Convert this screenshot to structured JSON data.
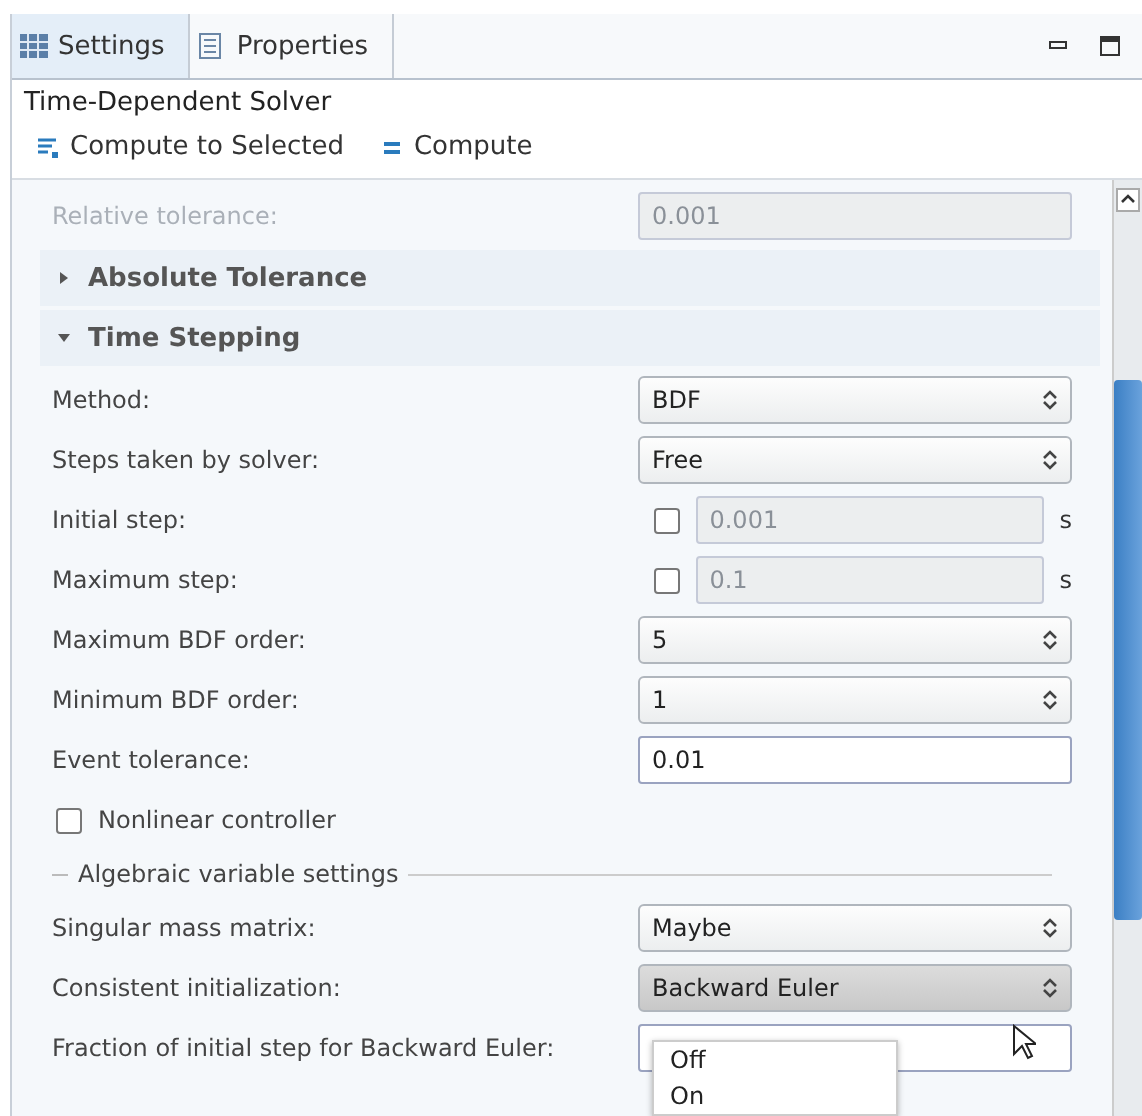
{
  "tabs": [
    {
      "label": "Settings",
      "selected": true
    },
    {
      "label": "Properties",
      "selected": false
    }
  ],
  "title": "Time-Dependent Solver",
  "toolbar": [
    {
      "label": "Compute to Selected",
      "kind": "selected"
    },
    {
      "label": "Compute",
      "kind": "all"
    }
  ],
  "relative_tolerance": {
    "label": "Relative tolerance:",
    "value": "0.001",
    "disabled": true
  },
  "sections": [
    {
      "label": "Absolute Tolerance",
      "expanded": false
    },
    {
      "label": "Time Stepping",
      "expanded": true
    }
  ],
  "rows": [
    {
      "kind": "select",
      "label": "Method:",
      "value": "BDF",
      "active": false
    },
    {
      "kind": "select",
      "label": "Steps taken by solver:",
      "value": "Free",
      "active": false
    },
    {
      "kind": "check_field",
      "label": "Initial step:",
      "checked": false,
      "value": "0.001",
      "unit": "s"
    },
    {
      "kind": "check_field",
      "label": "Maximum step:",
      "checked": false,
      "value": "0.1",
      "unit": "s"
    },
    {
      "kind": "select",
      "label": "Maximum BDF order:",
      "value": "5",
      "active": false
    },
    {
      "kind": "select",
      "label": "Minimum BDF order:",
      "value": "1",
      "active": false
    },
    {
      "kind": "text",
      "label": "Event tolerance:",
      "value": "0.01"
    },
    {
      "kind": "checkbox",
      "label": "Nonlinear controller",
      "checked": false
    },
    {
      "kind": "group",
      "label": "Algebraic variable settings"
    },
    {
      "kind": "select",
      "label": "Singular mass matrix:",
      "value": "Maybe",
      "active": false
    },
    {
      "kind": "select",
      "label": "Consistent initialization:",
      "value": "Backward Euler",
      "active": true
    },
    {
      "kind": "text",
      "label": "Fraction of initial step for Backward Euler:"
    }
  ],
  "popup": {
    "options": [
      "Off",
      "On"
    ]
  }
}
